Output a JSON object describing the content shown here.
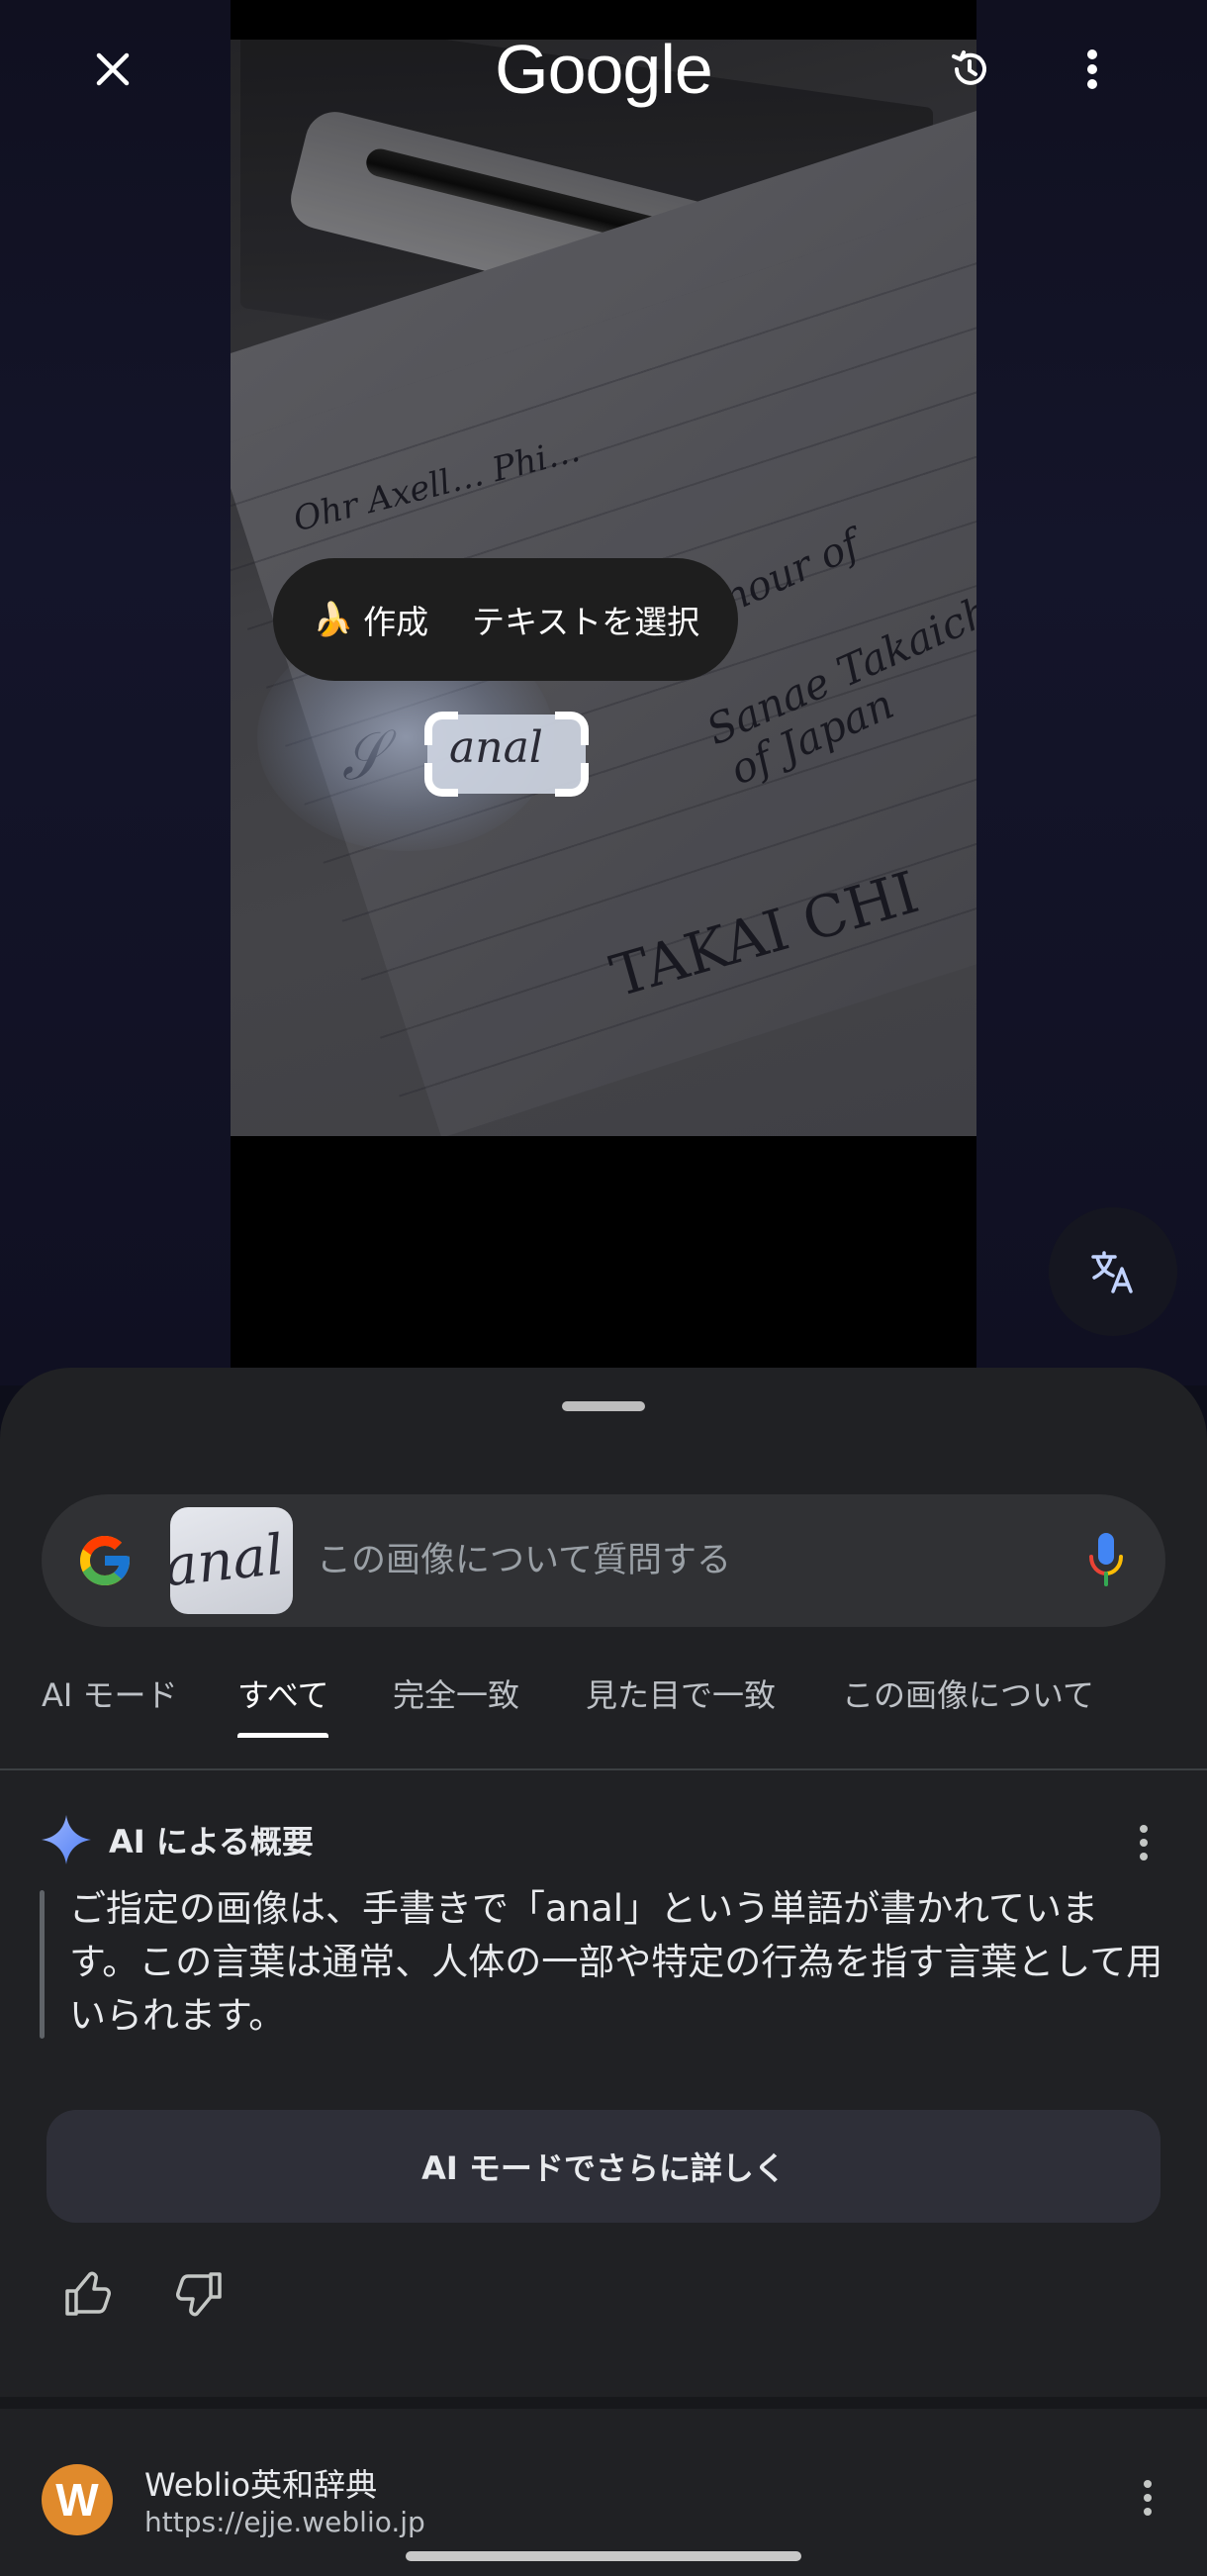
{
  "top_bar": {
    "logo_text": "Google",
    "close_icon": "close-icon",
    "history_icon": "history-icon",
    "menu_icon": "more-vert-icon"
  },
  "camera": {
    "bubble": {
      "create_emoji": "🍌",
      "create_label": "作成",
      "select_text_label": "テキストを選択"
    },
    "selected_word": "anal"
  },
  "search": {
    "placeholder": "この画像について質問する",
    "thumbnail_text": "anal"
  },
  "tabs": [
    {
      "label": "AI モード",
      "active": false
    },
    {
      "label": "すべて",
      "active": true
    },
    {
      "label": "完全一致",
      "active": false
    },
    {
      "label": "見た目で一致",
      "active": false
    },
    {
      "label": "この画像について",
      "active": false
    }
  ],
  "ai_overview": {
    "title": "AI による概要",
    "text": "ご指定の画像は、手書きで「anal」という単語が書かれています。この言葉は通常、人体の一部や特定の行為を指す言葉として用いられます。",
    "more_button": "AI モードでさらに詳しく"
  },
  "result": {
    "favicon_letter": "W",
    "site_name": "Weblio英和辞典",
    "url": "https://ejje.weblio.jp"
  },
  "colors": {
    "sheet_bg": "#202124",
    "search_bg": "#303134",
    "accent_blue": "#8ab4f8",
    "favicon": "#e08a2c"
  }
}
